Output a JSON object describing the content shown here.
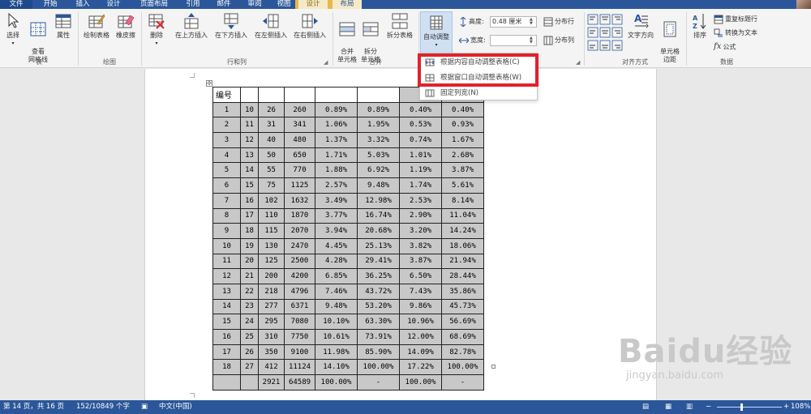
{
  "tabs": [
    {
      "label": "文件",
      "type": "file"
    },
    {
      "label": "开始",
      "type": "normal"
    },
    {
      "label": "插入",
      "type": "normal"
    },
    {
      "label": "设计",
      "type": "normal"
    },
    {
      "label": "页面布局",
      "type": "normal"
    },
    {
      "label": "引用",
      "type": "normal"
    },
    {
      "label": "邮件",
      "type": "normal"
    },
    {
      "label": "审阅",
      "type": "normal"
    },
    {
      "label": "视图",
      "type": "normal"
    },
    {
      "label": "设计",
      "type": "context"
    },
    {
      "label": "布局",
      "type": "context-active"
    }
  ],
  "ribbon": {
    "table_group": {
      "label": "表",
      "select": "选择",
      "gridlines": "查看\n网格线",
      "properties": "属性"
    },
    "draw_group": {
      "label": "绘图",
      "draw_table": "绘制表格",
      "eraser": "橡皮擦"
    },
    "rows_cols_group": {
      "label": "行和列",
      "delete": "删除",
      "insert_above": "在上方插入",
      "insert_below": "在下方插入",
      "insert_left": "在左侧插入",
      "insert_right": "在右侧插入"
    },
    "merge_group": {
      "label": "合并",
      "merge_cells": "合并\n单元格",
      "split_cells": "拆分\n单元格",
      "split_table": "拆分表格"
    },
    "cell_size_group": {
      "autofit": "自动调整",
      "height_label": "高度:",
      "height_value": "0.48 厘米",
      "width_label": "宽度:",
      "width_value": "",
      "distribute_rows": "分布行",
      "distribute_cols": "分布列"
    },
    "alignment_group": {
      "label": "对齐方式",
      "text_direction": "文字方向",
      "cell_margins": "单元格\n边距"
    },
    "data_group": {
      "label": "数据",
      "sort": "排序",
      "repeat_header": "重复标题行",
      "convert_text": "转换为文本",
      "formula": "公式"
    }
  },
  "autofit_menu": {
    "items": [
      "根据内容自动调整表格(C)",
      "根据窗口自动调整表格(W)",
      "固定列宽(N)"
    ]
  },
  "table": {
    "header": "编号",
    "rows": [
      [
        "1",
        "10",
        "26",
        "260",
        "0.89%",
        "0.89%",
        "0.40%",
        "0.40%"
      ],
      [
        "2",
        "11",
        "31",
        "341",
        "1.06%",
        "1.95%",
        "0.53%",
        "0.93%"
      ],
      [
        "3",
        "12",
        "40",
        "480",
        "1.37%",
        "3.32%",
        "0.74%",
        "1.67%"
      ],
      [
        "4",
        "13",
        "50",
        "650",
        "1.71%",
        "5.03%",
        "1.01%",
        "2.68%"
      ],
      [
        "5",
        "14",
        "55",
        "770",
        "1.88%",
        "6.92%",
        "1.19%",
        "3.87%"
      ],
      [
        "6",
        "15",
        "75",
        "1125",
        "2.57%",
        "9.48%",
        "1.74%",
        "5.61%"
      ],
      [
        "7",
        "16",
        "102",
        "1632",
        "3.49%",
        "12.98%",
        "2.53%",
        "8.14%"
      ],
      [
        "8",
        "17",
        "110",
        "1870",
        "3.77%",
        "16.74%",
        "2.90%",
        "11.04%"
      ],
      [
        "9",
        "18",
        "115",
        "2070",
        "3.94%",
        "20.68%",
        "3.20%",
        "14.24%"
      ],
      [
        "10",
        "19",
        "130",
        "2470",
        "4.45%",
        "25.13%",
        "3.82%",
        "18.06%"
      ],
      [
        "11",
        "20",
        "125",
        "2500",
        "4.28%",
        "29.41%",
        "3.87%",
        "21.94%"
      ],
      [
        "12",
        "21",
        "200",
        "4200",
        "6.85%",
        "36.25%",
        "6.50%",
        "28.44%"
      ],
      [
        "13",
        "22",
        "218",
        "4796",
        "7.46%",
        "43.72%",
        "7.43%",
        "35.86%"
      ],
      [
        "14",
        "23",
        "277",
        "6371",
        "9.48%",
        "53.20%",
        "9.86%",
        "45.73%"
      ],
      [
        "15",
        "24",
        "295",
        "7080",
        "10.10%",
        "63.30%",
        "10.96%",
        "56.69%"
      ],
      [
        "16",
        "25",
        "310",
        "7750",
        "10.61%",
        "73.91%",
        "12.00%",
        "68.69%"
      ],
      [
        "17",
        "26",
        "350",
        "9100",
        "11.98%",
        "85.90%",
        "14.09%",
        "82.78%"
      ],
      [
        "18",
        "27",
        "412",
        "11124",
        "14.10%",
        "100.00%",
        "17.22%",
        "100.00%"
      ],
      [
        "",
        "",
        "2921",
        "64589",
        "100.00%",
        "-",
        "100.00%",
        "-"
      ]
    ]
  },
  "watermark": {
    "main": "Baidu经验",
    "sub": "jingyan.baidu.com"
  },
  "status": {
    "page": "第 14 页，共 16 页",
    "words": "152/10849 个字",
    "language": "中文(中国)",
    "zoom": "108%"
  },
  "colors": {
    "accent": "#2b579a",
    "highlight": "#e0222a",
    "context_tab": "#e8b84a"
  }
}
